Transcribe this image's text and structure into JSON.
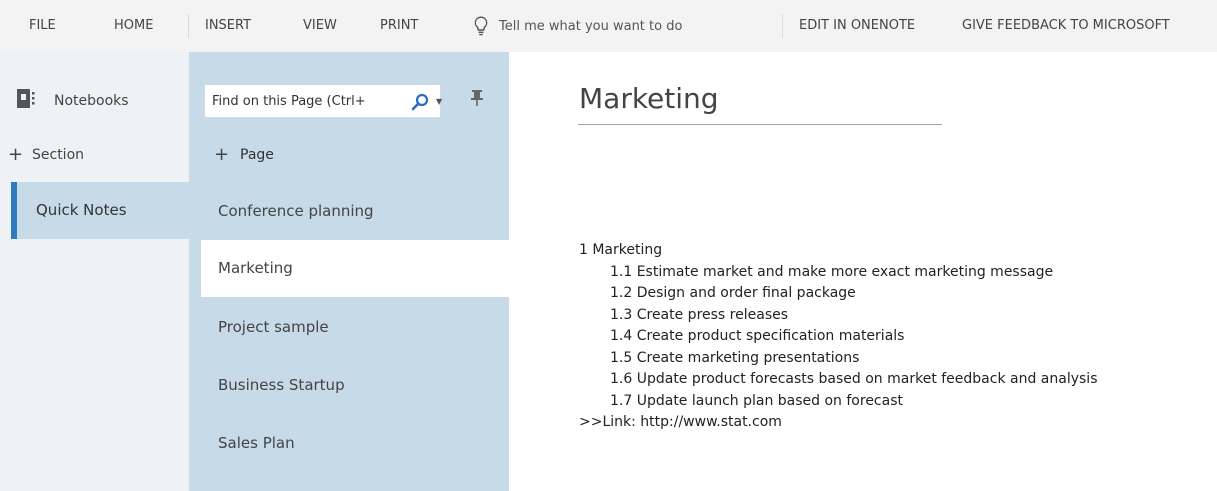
{
  "menu": {
    "file": "FILE",
    "home": "HOME",
    "insert": "INSERT",
    "view": "VIEW",
    "print": "PRINT",
    "tell_me": "Tell me what you want to do",
    "edit_in_onenote": "EDIT IN ONENOTE",
    "give_feedback": "GIVE FEEDBACK TO MICROSOFT"
  },
  "notebooks": {
    "header": "Notebooks",
    "add_section": "Section",
    "sections": [
      {
        "label": "Quick Notes",
        "selected": true
      }
    ]
  },
  "pages": {
    "search_placeholder": "Find on this Page (Ctrl+",
    "add_page": "Page",
    "items": [
      {
        "label": "Conference planning",
        "selected": false
      },
      {
        "label": "Marketing",
        "selected": true
      },
      {
        "label": "Project sample",
        "selected": false
      },
      {
        "label": "Business Startup",
        "selected": false
      },
      {
        "label": "Sales Plan",
        "selected": false
      }
    ]
  },
  "content": {
    "title": "Marketing",
    "heading": "1 Marketing",
    "subitems": [
      "1.1 Estimate market and make more exact marketing message",
      "1.2 Design and order final package",
      "1.3 Create press releases",
      "1.4 Create product specification materials",
      "1.5 Create marketing presentations",
      "1.6 Update product forecasts based on market feedback and analysis",
      "1.7 Update launch plan based on forecast"
    ],
    "link": ">>Link: http://www.stat.com"
  },
  "colors": {
    "menubar_bg": "#f3f3f3",
    "notebook_column_bg": "#eef2f5",
    "page_column_bg": "#c7dae8",
    "selected_section_accent": "#2e7bbd",
    "search_icon": "#2b6cc4"
  },
  "icons": [
    "notebook-icon",
    "lightbulb-icon",
    "search-icon",
    "chevron-down-icon",
    "pin-icon",
    "plus-icon"
  ]
}
